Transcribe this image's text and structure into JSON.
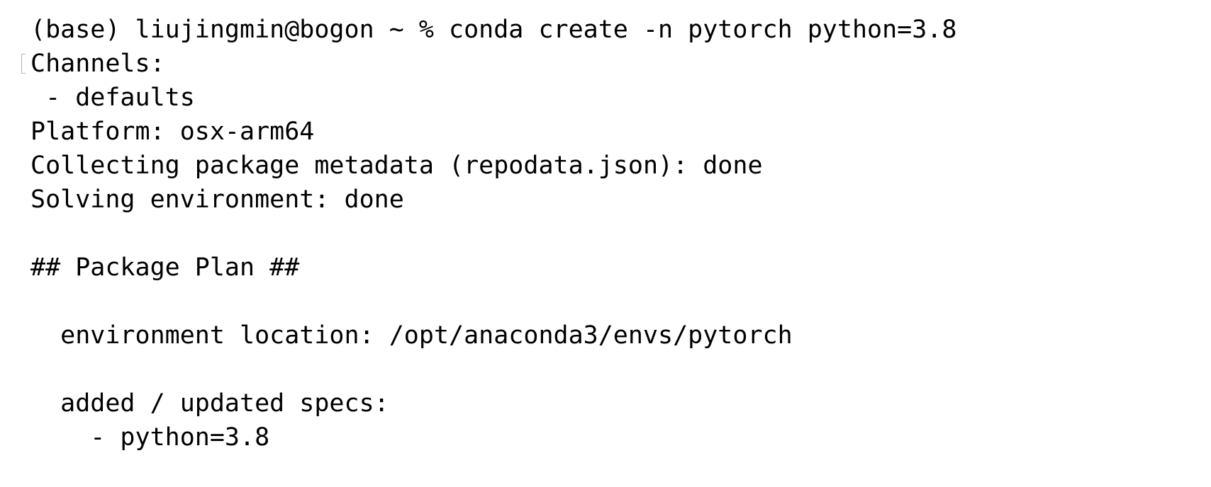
{
  "terminal": {
    "lines": [
      "(base) liujingmin@bogon ~ % conda create -n pytorch python=3.8",
      "Channels:",
      " - defaults",
      "Platform: osx-arm64",
      "Collecting package metadata (repodata.json): done",
      "Solving environment: done",
      "",
      "## Package Plan ##",
      "",
      "  environment location: /opt/anaconda3/envs/pytorch",
      "",
      "  added / updated specs:",
      "    - python=3.8"
    ]
  }
}
